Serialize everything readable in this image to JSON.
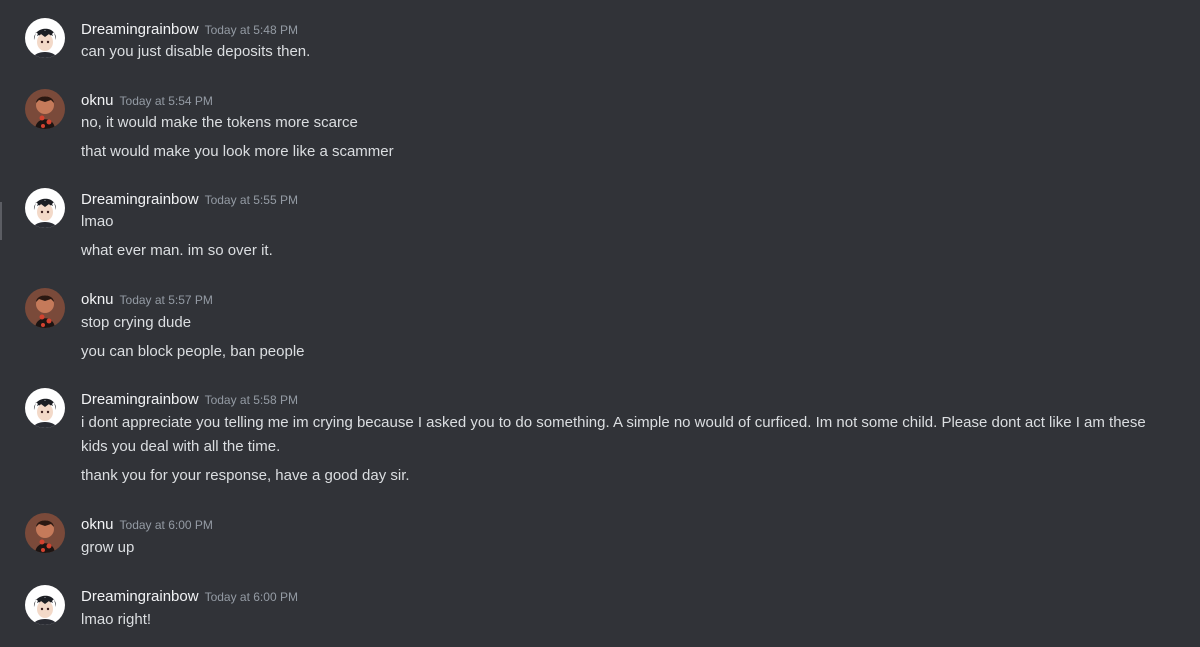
{
  "messages": [
    {
      "author": "Dreamingrainbow",
      "timestamp": "Today at 5:48 PM",
      "lines": [
        "can you just disable deposits then."
      ]
    },
    {
      "author": "oknu",
      "timestamp": "Today at 5:54 PM",
      "lines": [
        "no, it would make the tokens more scarce",
        "that would make you look more like a scammer"
      ]
    },
    {
      "author": "Dreamingrainbow",
      "timestamp": "Today at 5:55 PM",
      "lines": [
        "lmao",
        "what ever man. im so over it."
      ]
    },
    {
      "author": "oknu",
      "timestamp": "Today at 5:57 PM",
      "lines": [
        "stop crying dude",
        "you can block people, ban people"
      ]
    },
    {
      "author": "Dreamingrainbow",
      "timestamp": "Today at 5:58 PM",
      "lines": [
        "i dont appreciate you telling me im  crying because I asked you to do something. A simple no would of curficed. Im not some child. Please dont act like I am these kids you deal with all the time.",
        "thank you for your response, have a good day sir."
      ]
    },
    {
      "author": "oknu",
      "timestamp": "Today at 6:00 PM",
      "lines": [
        "grow up"
      ]
    },
    {
      "author": "Dreamingrainbow",
      "timestamp": "Today at 6:00 PM",
      "lines": [
        "lmao right!"
      ]
    }
  ],
  "colors": {
    "background": "#313338",
    "username": "#f2f3f5",
    "timestamp": "#949ba4",
    "text": "#dbdee1"
  }
}
